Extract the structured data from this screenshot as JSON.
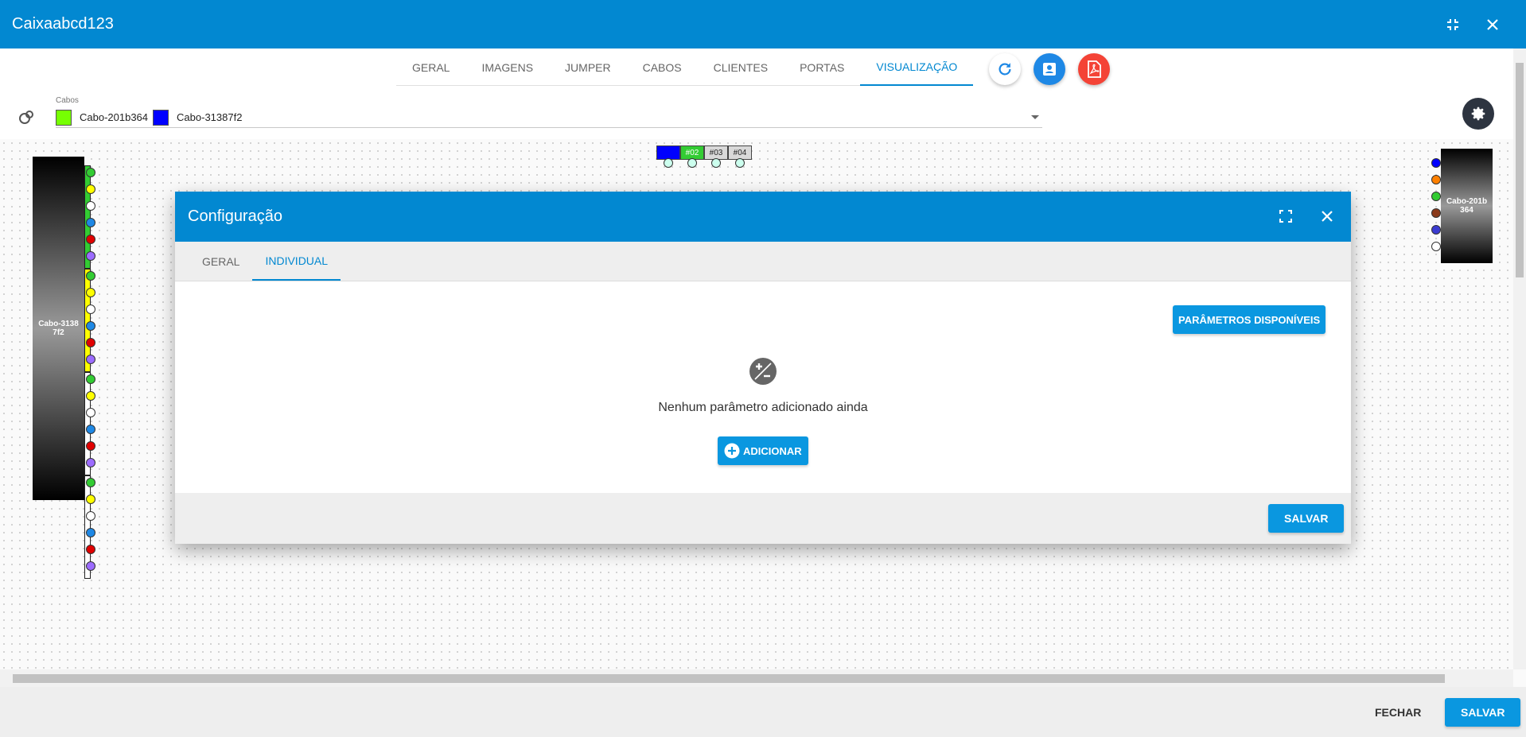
{
  "window": {
    "title": "Caixaabcd123"
  },
  "tabs": [
    {
      "label": "GERAL"
    },
    {
      "label": "IMAGENS"
    },
    {
      "label": "JUMPER"
    },
    {
      "label": "CABOS"
    },
    {
      "label": "CLIENTES"
    },
    {
      "label": "PORTAS"
    },
    {
      "label": "VISUALIZAÇÃO",
      "active": true
    }
  ],
  "cable_select": {
    "label": "Cabos",
    "chips": [
      {
        "label": "Cabo-201b364",
        "display": "Cabo-201b364",
        "color": "#76ff03"
      },
      {
        "label": "Cabo-31387f2",
        "display": "Cabo-31387f2",
        "color": "#0000ff"
      }
    ]
  },
  "canvas": {
    "left_cable": {
      "label": "Cabo-3138\n7f2"
    },
    "right_cable": {
      "label": "Cabo-201b\n364"
    },
    "splitter_ports": [
      {
        "label": "",
        "color": "#0000ff"
      },
      {
        "label": "#02",
        "color": "#33cc33"
      },
      {
        "label": "#03",
        "color": "#d9d9d9"
      },
      {
        "label": "#04",
        "color": "#d9d9d9"
      }
    ],
    "tube_colors": [
      "#33cc33",
      "#ffff00",
      "#ffffff",
      "#ffffff"
    ],
    "fiber_colors": [
      "#33cc33",
      "#ffff00",
      "#ffffff",
      "#1e88e5",
      "#e00000",
      "#9c6cff"
    ],
    "right_fiber_colors": [
      "#0000ff",
      "#ff8000",
      "#33cc33",
      "#8b3a1a",
      "#3b3bd1",
      "#ffffff"
    ]
  },
  "modal": {
    "title": "Configuração",
    "tabs": [
      {
        "label": "GERAL"
      },
      {
        "label": "INDIVIDUAL",
        "active": true
      }
    ],
    "params_button": "PARÂMETROS DISPONÍVEIS",
    "empty_text": "Nenhum parâmetro adicionado ainda",
    "add_button": "ADICIONAR",
    "save_button": "SALVAR"
  },
  "footer": {
    "close_button": "FECHAR",
    "save_button": "SALVAR"
  },
  "colors": {
    "primary": "#0288d1",
    "button": "#0a97e0",
    "pdf": "#f44336",
    "user": "#1e88e5"
  }
}
